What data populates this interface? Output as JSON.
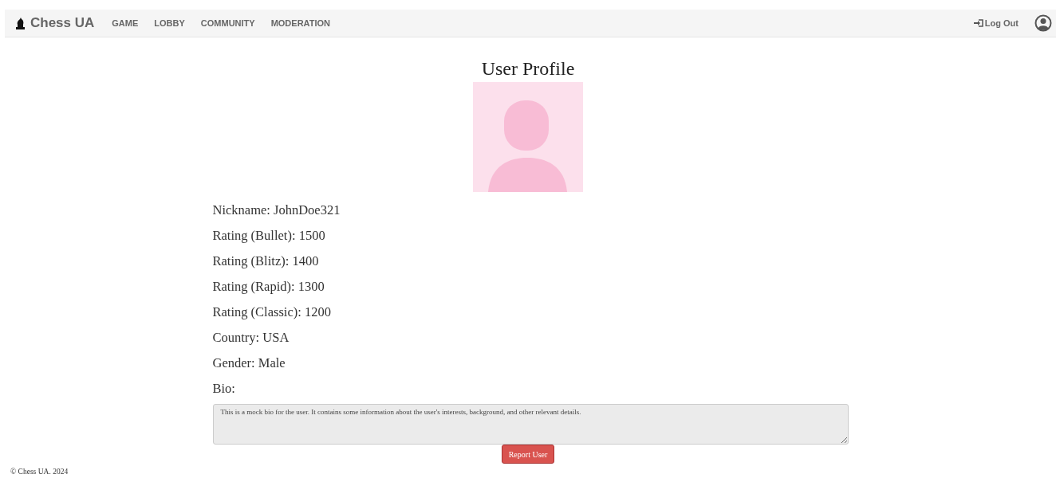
{
  "navbar": {
    "brand": "Chess UA",
    "links": [
      "GAME",
      "LOBBY",
      "COMMUNITY",
      "MODERATION"
    ],
    "logout": "Log Out"
  },
  "profile": {
    "title": "User Profile",
    "fields": [
      {
        "label": "Nickname:",
        "value": "JohnDoe321"
      },
      {
        "label": "Rating (Bullet):",
        "value": "1500"
      },
      {
        "label": "Rating (Blitz):",
        "value": "1400"
      },
      {
        "label": "Rating (Rapid):",
        "value": "1300"
      },
      {
        "label": "Rating (Classic):",
        "value": "1200"
      },
      {
        "label": "Country:",
        "value": "USA"
      },
      {
        "label": "Gender:",
        "value": "Male"
      }
    ],
    "bio_label": "Bio:",
    "bio": {
      "value": "This is a mock bio for the user. It contains some information about the user's interests, background, and other relevant details."
    },
    "report_button": "Report User"
  },
  "footer": "© Chess UA. 2024"
}
